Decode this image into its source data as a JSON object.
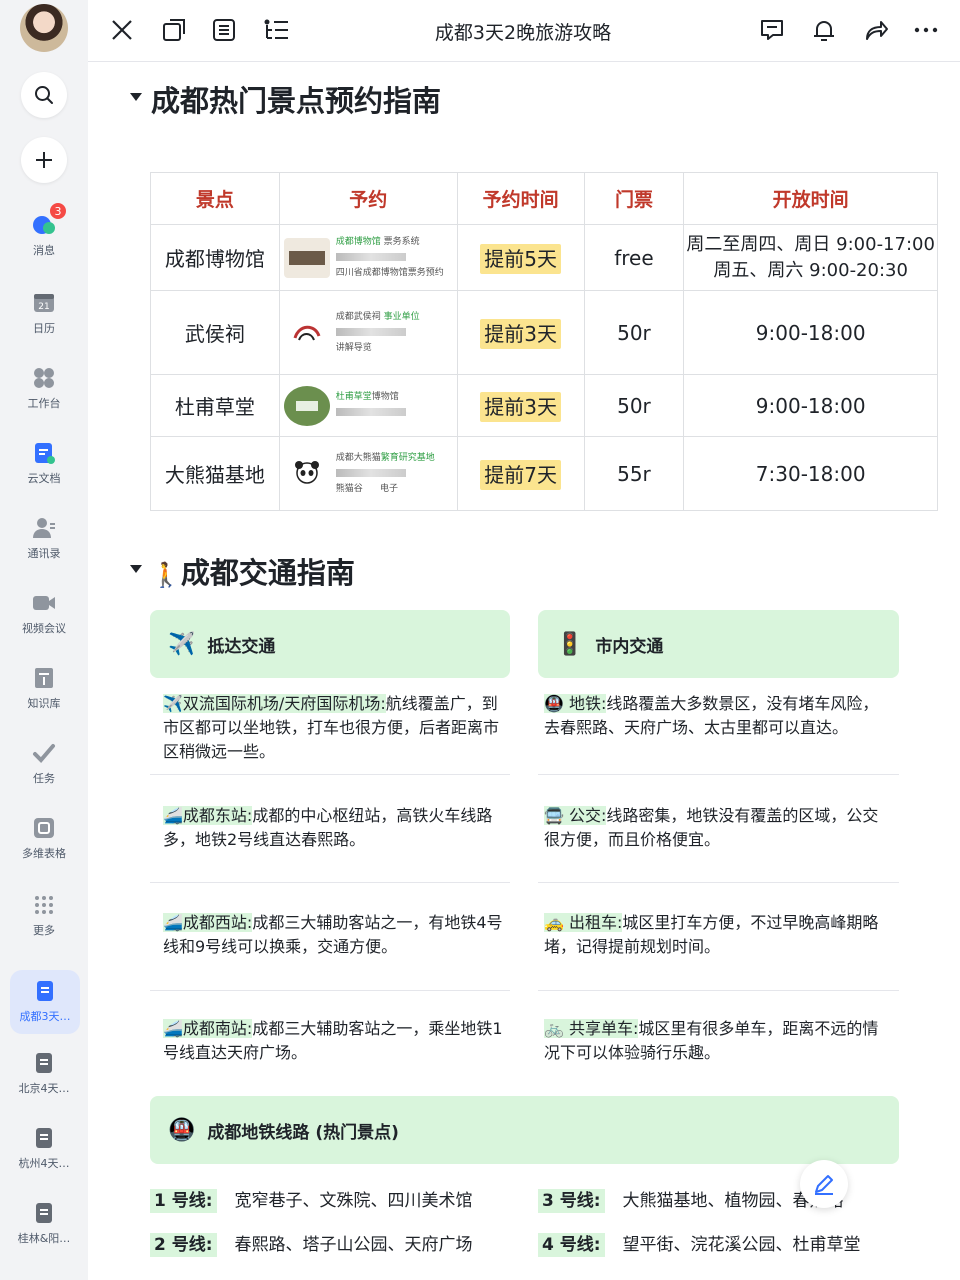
{
  "window": {
    "title": "成都3天2晚旅游攻略"
  },
  "sidebar": {
    "message_badge": "3",
    "items": [
      {
        "label": "消息",
        "icon": "message-icon"
      },
      {
        "label": "日历",
        "icon": "calendar-icon"
      },
      {
        "label": "工作台",
        "icon": "workbench-icon"
      },
      {
        "label": "云文档",
        "icon": "cloud-doc-icon"
      },
      {
        "label": "通讯录",
        "icon": "contacts-icon"
      },
      {
        "label": "视频会议",
        "icon": "video-icon"
      },
      {
        "label": "知识库",
        "icon": "wiki-icon"
      },
      {
        "label": "任务",
        "icon": "task-icon"
      },
      {
        "label": "多维表格",
        "icon": "base-icon"
      },
      {
        "label": "更多",
        "icon": "more-icon"
      }
    ],
    "docs": [
      {
        "label": "成都3天…",
        "active": true
      },
      {
        "label": "北京4天…",
        "active": false
      },
      {
        "label": "杭州4天…",
        "active": false
      },
      {
        "label": "桂林&阳…",
        "active": false
      }
    ]
  },
  "section1": {
    "title": "成都热门景点预约指南",
    "headers": [
      "景点",
      "予约",
      "予约时间",
      "门票",
      "开放时间"
    ],
    "rows": [
      {
        "name": "成都博物馆",
        "book": "提前5天",
        "ticket": "free",
        "hours1": "周二至周四、周日  9:00-17:00",
        "hours2": "周五、周六  9:00-20:30",
        "thumb1": "成都博物馆",
        "thumb1b": "票务系统",
        "thumb2": "四川省成都博物馆票务预约",
        "thumb3": ""
      },
      {
        "name": "武侯祠",
        "book": "提前3天",
        "ticket": "50r",
        "hours1": "9:00-18:00",
        "hours2": "",
        "thumb1": "成都武侯祠",
        "thumb1b": "事业单位",
        "thumb2": "讲解导览",
        "thumb3": ""
      },
      {
        "name": "杜甫草堂",
        "book": "提前3天",
        "ticket": "50r",
        "hours1": "9:00-18:00",
        "hours2": "",
        "thumb1": "杜甫草堂",
        "thumb1b": "博物馆",
        "thumb2": "",
        "thumb3": ""
      },
      {
        "name": "大熊猫基地",
        "book": "提前7天",
        "ticket": "55r",
        "hours1": "7:30-18:00",
        "hours2": "",
        "thumb1": "成都大熊猫",
        "thumb1b": "繁育研究基地",
        "thumb2": "熊猫谷",
        "thumb3": "电子"
      }
    ]
  },
  "section2": {
    "title": "成都交通指南",
    "left_head": "抵达交通",
    "right_head": "市内交通",
    "left": [
      {
        "icon": "✈️",
        "tag": "双流国际机场/天府国际机场:",
        "text": "航线覆盖广，到市区都可以坐地铁，打车也很方便，后者距离市区稍微远一些。"
      },
      {
        "icon": "🚄",
        "tag": "成都东站:",
        "text": "成都的中心枢纽站，高铁火车线路多，地铁2号线直达春熙路。"
      },
      {
        "icon": "🚄",
        "tag": "成都西站:",
        "text": "成都三大辅助客站之一，有地铁4号线和9号线可以换乘，交通方便。"
      },
      {
        "icon": "🚄",
        "tag": "成都南站:",
        "text": "成都三大辅助客站之一，乘坐地铁1号线直达天府广场。"
      }
    ],
    "right": [
      {
        "icon": "🚇",
        "tag": " 地铁:",
        "text": "线路覆盖大多数景区，没有堵车风险，去春熙路、天府广场、太古里都可以直达。"
      },
      {
        "icon": "🚍",
        "tag": " 公交:",
        "text": "线路密集，地铁没有覆盖的区域，公交很方便，而且价格便宜。"
      },
      {
        "icon": "🚕",
        "tag": " 出租车:",
        "text": "城区里打车方便，不过早晚高峰期略堵，记得提前规划时间。"
      },
      {
        "icon": "🚲",
        "tag": " 共享单车:",
        "text": "城区里有很多单车，距离不远的情况下可以体验骑行乐趣。"
      }
    ],
    "metro_head": "成都地铁线路 (热门景点)",
    "metro": [
      {
        "line": "1 号线:",
        "stops": "宽窄巷子、文殊院、四川美术馆"
      },
      {
        "line": "3 号线:",
        "stops": "大熊猫基地、植物园、春熙路"
      },
      {
        "line": "2 号线:",
        "stops": "春熙路、塔子山公园、天府广场"
      },
      {
        "line": "4 号线:",
        "stops": "望平街、浣花溪公园、杜甫草堂"
      }
    ]
  }
}
